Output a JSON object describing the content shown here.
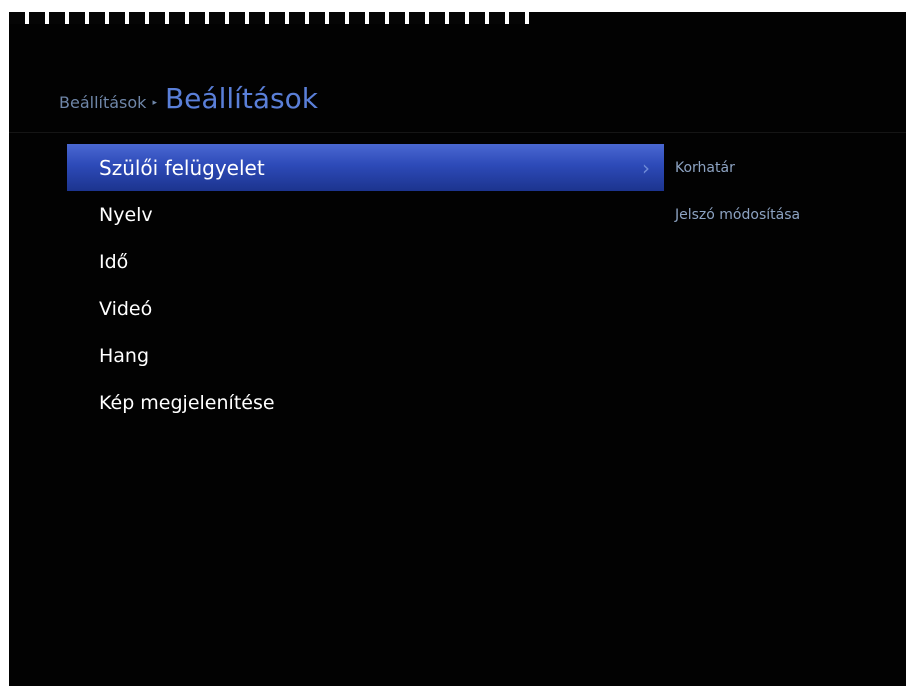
{
  "breadcrumb": {
    "parent": "Beállítások",
    "separator": "▸",
    "current": "Beállítások"
  },
  "menu": {
    "items": [
      {
        "label": "Szülői felügyelet",
        "selected": true
      },
      {
        "label": "Nyelv"
      },
      {
        "label": "Idő"
      },
      {
        "label": "Videó"
      },
      {
        "label": "Hang"
      },
      {
        "label": "Kép megjelenítése"
      }
    ],
    "chevron": "›"
  },
  "submenu": {
    "items": [
      {
        "label": "Korhatár"
      },
      {
        "label": "Jelszó módosítása"
      }
    ]
  },
  "colors": {
    "background": "#020202",
    "selection": "#2d4ab8",
    "title": "#5a7fd8",
    "breadcrumb": "#6f86a8",
    "submenu_text": "#8da3c2"
  }
}
